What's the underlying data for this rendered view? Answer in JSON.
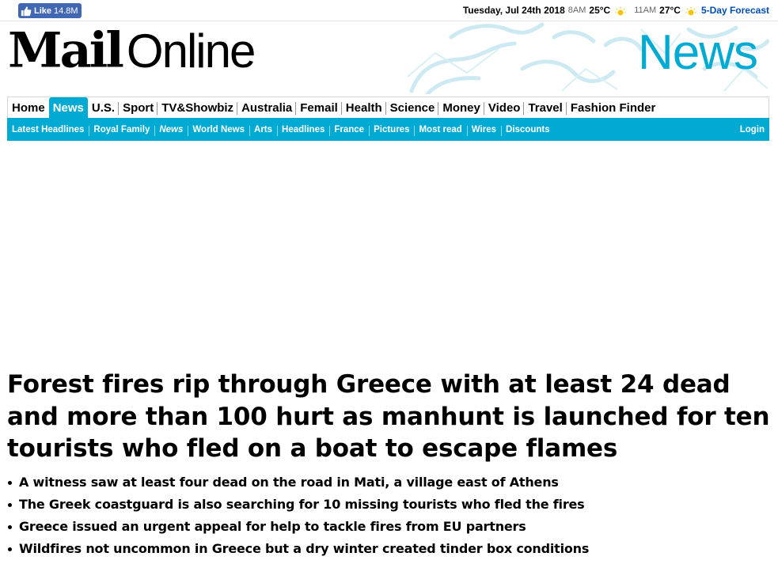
{
  "topbar": {
    "like_label": "Like",
    "like_count": "14.8M",
    "date": "Tuesday, Jul 24th 2018",
    "weather": [
      {
        "time": "8AM",
        "temp": "25°C",
        "icon": "sun-icon"
      },
      {
        "time": "11AM",
        "temp": "27°C",
        "icon": "sun-icon"
      }
    ],
    "forecast_link": "5-Day Forecast"
  },
  "masthead": {
    "logo_mail": "Mail",
    "logo_online": "Online",
    "channel": "News",
    "colors": {
      "accent": "#00aad2",
      "art": "#cdeaf3"
    }
  },
  "nav_primary": [
    {
      "label": "Home",
      "active": false
    },
    {
      "label": "News",
      "active": true
    },
    {
      "label": "U.S.",
      "active": false
    },
    {
      "label": "Sport",
      "active": false
    },
    {
      "label": "TV&Showbiz",
      "active": false
    },
    {
      "label": "Australia",
      "active": false
    },
    {
      "label": "Femail",
      "active": false
    },
    {
      "label": "Health",
      "active": false
    },
    {
      "label": "Science",
      "active": false
    },
    {
      "label": "Money",
      "active": false
    },
    {
      "label": "Video",
      "active": false
    },
    {
      "label": "Travel",
      "active": false
    },
    {
      "label": "Fashion Finder",
      "active": false
    }
  ],
  "nav_secondary": [
    {
      "label": "Latest Headlines",
      "current": false
    },
    {
      "label": "Royal Family",
      "current": false
    },
    {
      "label": "News",
      "current": true
    },
    {
      "label": "World News",
      "current": false
    },
    {
      "label": "Arts",
      "current": false
    },
    {
      "label": "Headlines",
      "current": false
    },
    {
      "label": "France",
      "current": false
    },
    {
      "label": "Pictures",
      "current": false
    },
    {
      "label": "Most read",
      "current": false
    },
    {
      "label": "Wires",
      "current": false
    },
    {
      "label": "Discounts",
      "current": false
    }
  ],
  "login_label": "Login",
  "article": {
    "headline": "Forest fires rip through Greece with at least 24 dead and more than 100 hurt as manhunt is launched for ten tourists who fled on a boat to escape flames",
    "bullets": [
      "A witness saw at least four dead on the road in Mati, a village east of Athens",
      "The Greek coastguard is also searching for 10 missing tourists who fled the fires",
      "Greece issued an urgent appeal for help to tackle fires from EU partners",
      "Wildfires not uncommon in Greece but a dry winter created tinder box conditions"
    ]
  }
}
